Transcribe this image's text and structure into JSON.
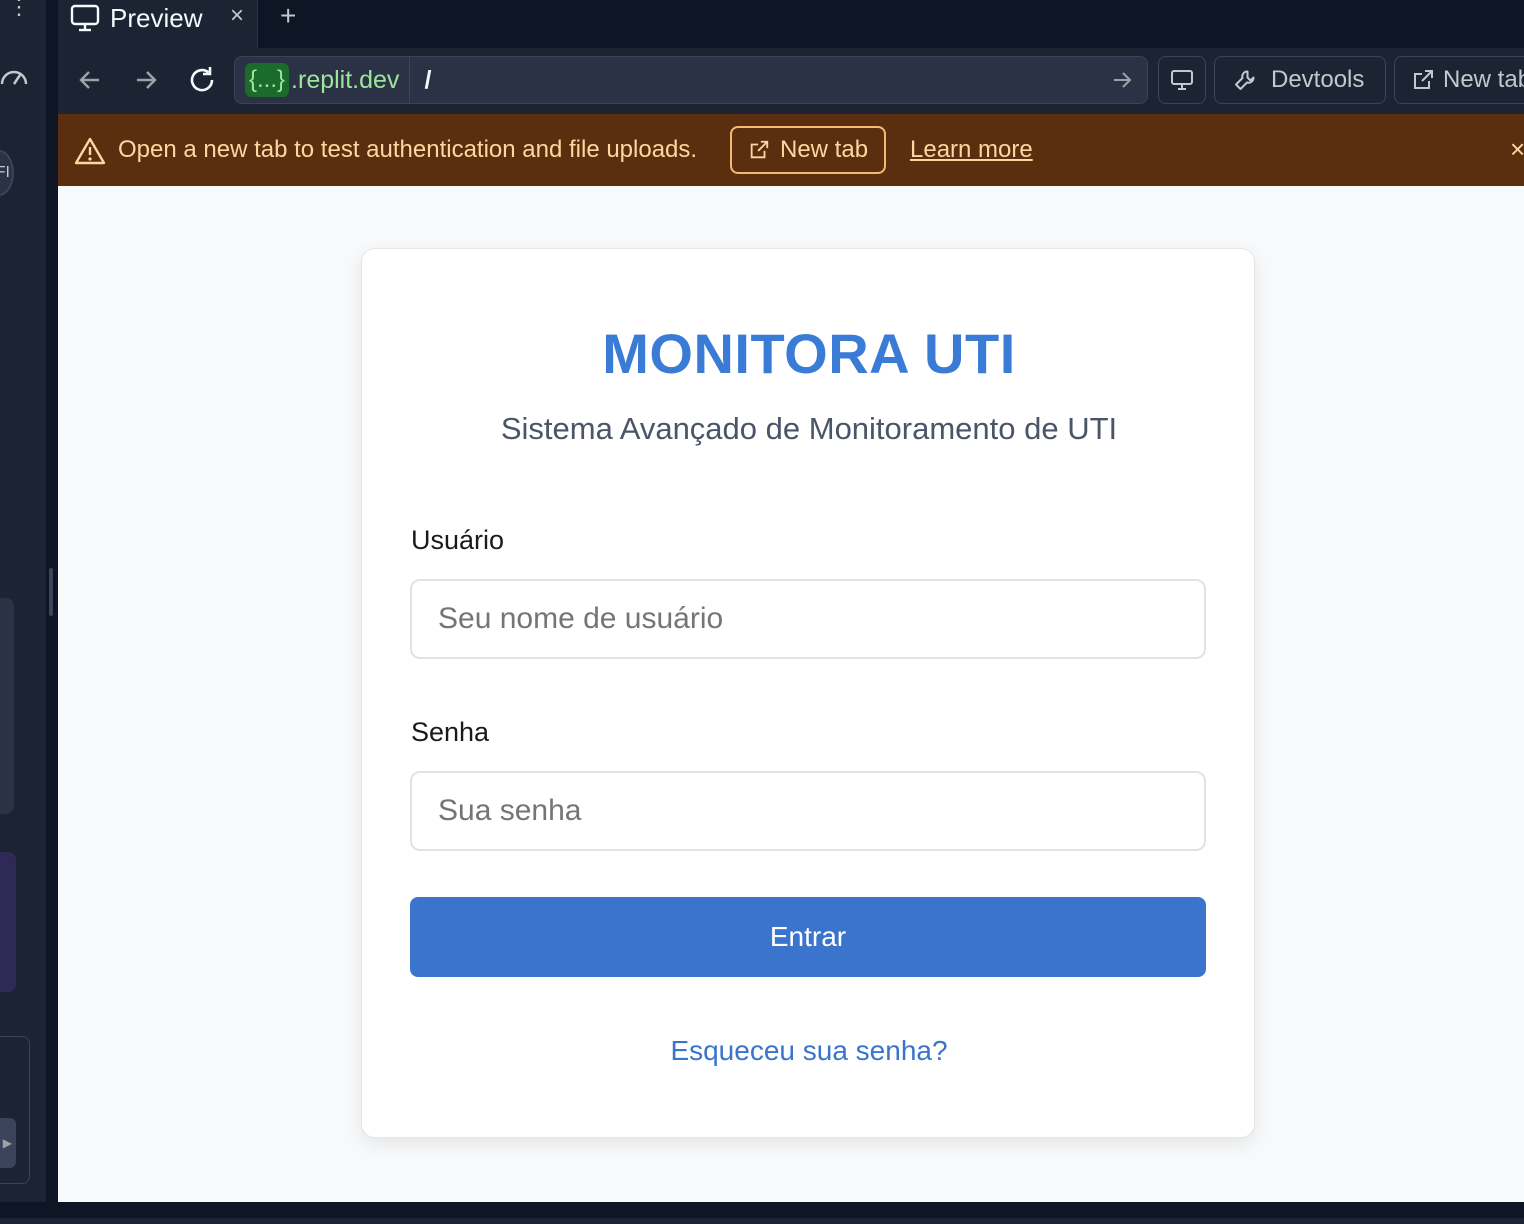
{
  "tabstrip": {
    "active_tab_title": "Preview",
    "close_glyph": "×",
    "add_glyph": "+"
  },
  "navbar": {
    "url_host_chip": "{...}",
    "url_host": ".replit.dev",
    "url_path": "/",
    "devtools_label": "Devtools",
    "newtab_label": "New tab"
  },
  "banner": {
    "message": "Open a new tab to test authentication and file uploads.",
    "button_label": "New tab",
    "link_label": "Learn more",
    "close_glyph": "×",
    "background": "#5a2e0e"
  },
  "sidebar": {
    "menu_glyph": "⋮",
    "avatar_text": "FI",
    "play_glyph": "▶"
  },
  "login": {
    "title": "MONITORA UTI",
    "subtitle": "Sistema Avançado de Monitoramento de UTI",
    "username_label": "Usuário",
    "username_placeholder": "Seu nome de usuário",
    "password_label": "Senha",
    "password_placeholder": "Sua senha",
    "submit_label": "Entrar",
    "forgot_link": "Esqueceu sua senha?",
    "accent_color": "#3a74cc"
  }
}
